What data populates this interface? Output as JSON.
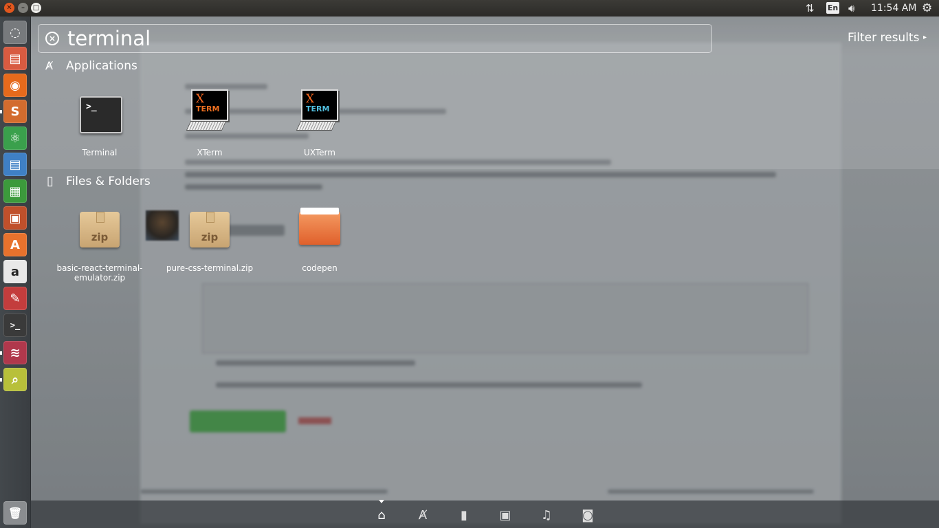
{
  "top_panel": {
    "window_buttons": [
      "close",
      "minimize",
      "maximize"
    ],
    "keyboard_layout": "En",
    "clock": "11:54 AM"
  },
  "launcher": {
    "items": [
      {
        "name": "dash-home-icon",
        "glyph": "◌",
        "color": "#777a7d"
      },
      {
        "name": "files-icon",
        "glyph": "▤",
        "color": "#d85b41"
      },
      {
        "name": "firefox-icon",
        "glyph": "◉",
        "color": "#e66a1c"
      },
      {
        "name": "sublime-text-icon",
        "glyph": "S",
        "color": "#d36c2e"
      },
      {
        "name": "atom-icon",
        "glyph": "⚛",
        "color": "#3aa04c"
      },
      {
        "name": "libreoffice-writer-icon",
        "glyph": "▤",
        "color": "#3f80c5"
      },
      {
        "name": "libreoffice-calc-icon",
        "glyph": "▦",
        "color": "#3c9a3c"
      },
      {
        "name": "libreoffice-impress-icon",
        "glyph": "▣",
        "color": "#c0502b"
      },
      {
        "name": "software-center-icon",
        "glyph": "A",
        "color": "#e8722d"
      },
      {
        "name": "amazon-icon",
        "glyph": "a",
        "color": "#e8e8e8"
      },
      {
        "name": "system-settings-icon",
        "glyph": "✎",
        "color": "#c33d3d"
      },
      {
        "name": "terminal-icon",
        "glyph": ">_",
        "color": "#3a3a3a"
      },
      {
        "name": "editor-icon",
        "glyph": "≋",
        "color": "#b0384c"
      },
      {
        "name": "search-tool-icon",
        "glyph": "⌕",
        "color": "#b8c03a"
      }
    ],
    "trash": {
      "glyph": "🗑"
    }
  },
  "search": {
    "query": "terminal",
    "filter_label": "Filter results"
  },
  "categories": {
    "applications": {
      "title": "Applications",
      "items": [
        {
          "label": "Terminal"
        },
        {
          "label": "XTerm",
          "icon_x": "X",
          "icon_term": "TERM"
        },
        {
          "label": "UXTerm",
          "icon_x": "X",
          "icon_term": "TERM"
        }
      ]
    },
    "files": {
      "title": "Files & Folders",
      "items": [
        {
          "label": "basic-react-terminal-emulator.zip",
          "icon_text": "zip"
        },
        {
          "label": "pure-css-terminal.zip",
          "icon_text": "zip"
        },
        {
          "label": "codepen"
        }
      ]
    }
  },
  "lenses": [
    "home-lens-icon",
    "applications-lens-icon",
    "files-lens-icon",
    "video-lens-icon",
    "music-lens-icon",
    "photo-lens-icon"
  ],
  "colors": {
    "accent_orange": "#e2571e",
    "panel": "#2b2a27"
  }
}
